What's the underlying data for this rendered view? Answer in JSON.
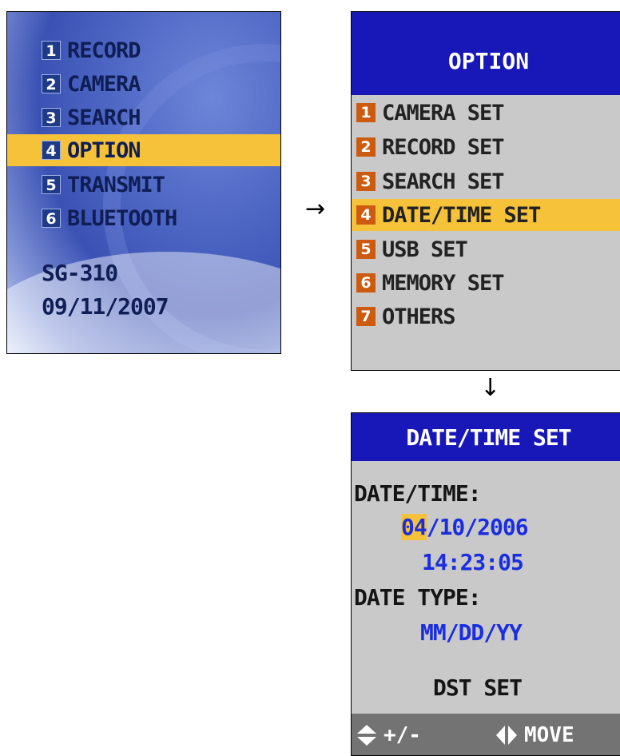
{
  "main_menu": {
    "items": [
      {
        "num": "1",
        "label": "RECORD"
      },
      {
        "num": "2",
        "label": "CAMERA"
      },
      {
        "num": "3",
        "label": "SEARCH"
      },
      {
        "num": "4",
        "label": "OPTION"
      },
      {
        "num": "5",
        "label": "TRANSMIT"
      },
      {
        "num": "6",
        "label": "BLUETOOTH"
      }
    ],
    "selected_item": "OPTION",
    "model": "SG-310",
    "date": "09/11/2007"
  },
  "arrows": {
    "right": "→",
    "down": "↓"
  },
  "option_menu": {
    "title": "OPTION",
    "items": [
      {
        "num": "1",
        "label": "CAMERA SET"
      },
      {
        "num": "2",
        "label": "RECORD SET"
      },
      {
        "num": "3",
        "label": "SEARCH SET"
      },
      {
        "num": "4",
        "label": "DATE/TIME SET"
      },
      {
        "num": "5",
        "label": "USB SET"
      },
      {
        "num": "6",
        "label": "MEMORY SET"
      },
      {
        "num": "7",
        "label": "OTHERS"
      }
    ],
    "selected_item": "DATE/TIME SET"
  },
  "datetime_screen": {
    "title": "DATE/TIME SET",
    "datetime_label": "DATE/TIME:",
    "date_month": "04",
    "date_rest": "/10/2006",
    "time": "14:23:05",
    "date_type_label": "DATE TYPE:",
    "date_type_value": "MM/DD/YY",
    "dst_label": "DST SET",
    "footer": {
      "left_icon": "up-down-icon",
      "left_text": "+/-",
      "right_icon": "left-right-icon",
      "right_text": "MOVE"
    }
  },
  "colors": {
    "highlight": "#f6c23a",
    "title_bar": "#1818b8",
    "value_blue": "#1a2ee0",
    "screen_gray": "#c9c9c9",
    "footer_gray": "#737373"
  }
}
